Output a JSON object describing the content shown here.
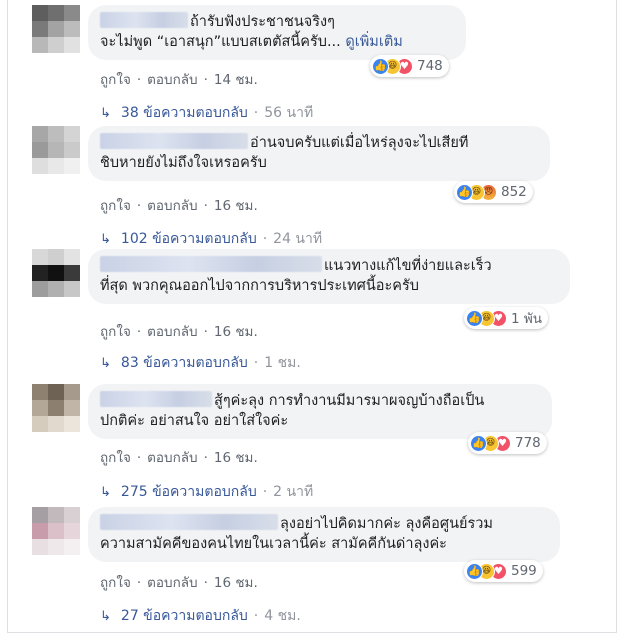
{
  "comments": [
    {
      "line1": "ถ้ารับฟังประชาชนจริงๆ",
      "line2": "จะไม่พูด “เอาสนุก”แบบสเตตัสนี้ครับ...",
      "see_more": "ดูเพิ่มเติม",
      "like": "ถูกใจ",
      "reply": "ตอบกลับ",
      "time": "14 ชม.",
      "reaction_count": "748",
      "reaction_icons": [
        "like-icon",
        "haha-icon",
        "love-icon"
      ],
      "replies": "38 ข้อความตอบกลับ",
      "replies_time": "56 นาที"
    },
    {
      "line1": "อ่านจบครับแต่เมื่อไหร่ลุงจะไปเสียที",
      "line2": "ชิบหายยังไม่ถึงใจเหรอครับ",
      "like": "ถูกใจ",
      "reply": "ตอบกลับ",
      "time": "16 ชม.",
      "reaction_count": "852",
      "reaction_icons": [
        "like-icon",
        "haha-icon",
        "angry-icon"
      ],
      "replies": "102 ข้อความตอบกลับ",
      "replies_time": "24 นาที"
    },
    {
      "line1": "แนวทางแก้ไขที่ง่ายและเร็ว",
      "line2": "ที่สุด พวกคุณออกไปจากการบริหารประเทศนี้อะครับ",
      "like": "ถูกใจ",
      "reply": "ตอบกลับ",
      "time": "16 ชม.",
      "reaction_count": "1 พัน",
      "reaction_icons": [
        "like-icon",
        "haha-icon",
        "love-icon"
      ],
      "replies": "83 ข้อความตอบกลับ",
      "replies_time": "1 ชม."
    },
    {
      "line1": "สู้ๆค่ะลุง การทำงานมีมารมาผจญบ้างถือเป็น",
      "line2": "ปกติค่ะ อย่าสนใจ อย่าใส่ใจค่ะ",
      "like": "ถูกใจ",
      "reply": "ตอบกลับ",
      "time": "16 ชม.",
      "reaction_count": "778",
      "reaction_icons": [
        "like-icon",
        "haha-icon",
        "love-icon"
      ],
      "replies": "275 ข้อความตอบกลับ",
      "replies_time": "2 นาที"
    },
    {
      "line1": "ลุงอย่าไปคิดมากค่ะ ลุงคือศูนย์รวม",
      "line2": "ความสามัคคีของคนไทยในเวลานี้ค่ะ สามัคคีกันด่าลุงค่ะ",
      "like": "ถูกใจ",
      "reply": "ตอบกลับ",
      "time": "16 ชม.",
      "reaction_count": "599",
      "reaction_icons": [
        "like-icon",
        "haha-icon",
        "love-icon"
      ],
      "replies": "27 ข้อความตอบกลับ",
      "replies_time": "4 ชม."
    }
  ]
}
